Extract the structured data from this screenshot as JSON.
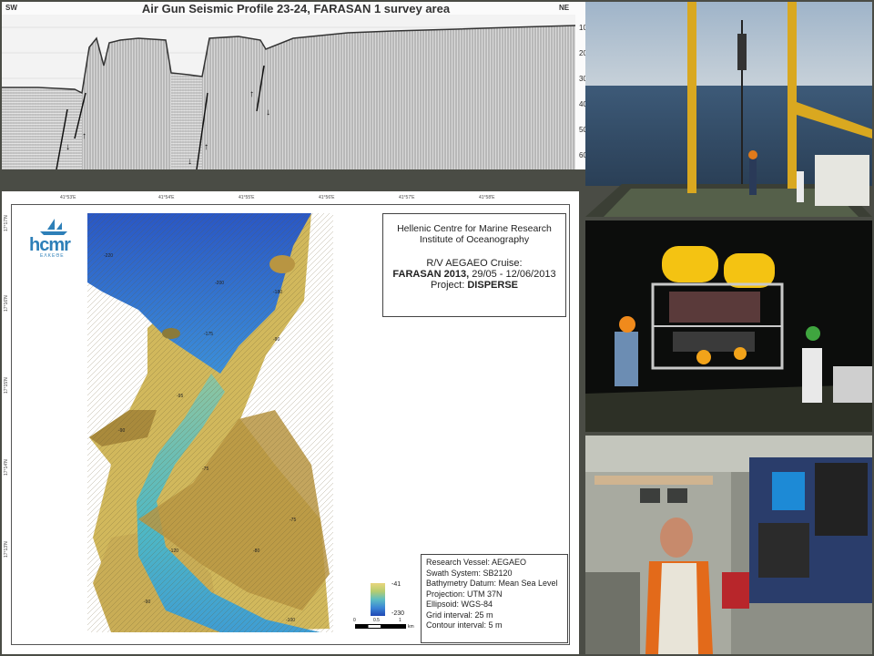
{
  "seismic": {
    "title": "Air Gun Seismic Profile 23-24, FARASAN 1 survey area",
    "dir_left": "SW",
    "dir_right": "NE",
    "depth_labels": [
      "100",
      "200",
      "300",
      "400",
      "500",
      "600"
    ]
  },
  "map": {
    "lon_labels": [
      "41°53'E",
      "41°54'E",
      "41°55'E",
      "41°56'E",
      "41°57'E",
      "41°58'E"
    ],
    "lat_labels": [
      "17°17'N",
      "17°16'N",
      "17°15'N",
      "17°14'N",
      "17°13'N"
    ],
    "logo": {
      "name": "hcmr",
      "sub": "ΕΛΚΕΘΕ"
    },
    "title_box": {
      "line1": "Hellenic Centre for Marine Research",
      "line2": "Institute of Oceanography",
      "line3": "R/V AEGAEO Cruise:",
      "cruise": "FARASAN 2013,",
      "dates": " 29/05 - 12/06/2013",
      "project_label": "Project: ",
      "project": "DISPERSE"
    },
    "info": [
      "Research Vessel: AEGAEO",
      "Swath System: SB2120",
      "Bathymetry Datum: Mean Sea Level",
      "Projection: UTM 37N",
      "Ellipsoid: WGS-84",
      "Grid interval: 25 m",
      "Contour interval: 5 m"
    ],
    "colorbar": {
      "max": "-41",
      "min": "-230"
    },
    "scale": {
      "zero": "0",
      "half": "0.5",
      "one": "1",
      "unit": "km"
    },
    "contour_labels": [
      "-220",
      "-200",
      "-180",
      "-175",
      "-90",
      "-95",
      "-90",
      "-75",
      "-75",
      "-120",
      "-80",
      "-90",
      "-100"
    ]
  },
  "colors": {
    "background": "#4a4c45",
    "deep": "#2148b4",
    "shallow": "#e9d57d",
    "accent_logo": "#2d7fb8"
  }
}
